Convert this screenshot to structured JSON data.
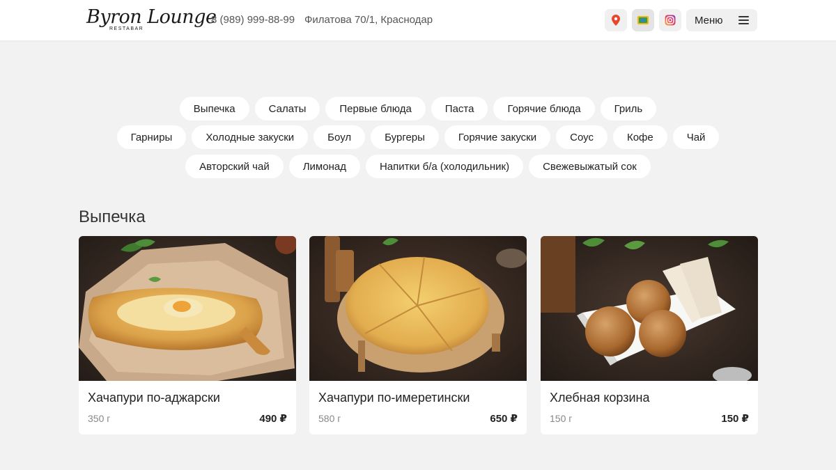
{
  "header": {
    "logo_script": "Byron Lounge",
    "logo_sub": "RESTABAR",
    "phone": "8 (989) 999-88-99",
    "address": "Филатова 70/1, Краснодар",
    "icons": [
      "map-pin-icon",
      "gallery-icon",
      "instagram-icon"
    ],
    "menu_label": "Меню"
  },
  "categories": {
    "row1": [
      "Выпечка",
      "Салаты",
      "Первые блюда",
      "Паста",
      "Горячие блюда",
      "Гриль"
    ],
    "row2": [
      "Гарниры",
      "Холодные закуски",
      "Боул",
      "Бургеры",
      "Горячие закуски",
      "Соус",
      "Кофе",
      "Чай"
    ],
    "row3": [
      "Авторский чай",
      "Лимонад",
      "Напитки б/а (холодильник)",
      "Свежевыжатый сок"
    ]
  },
  "section": {
    "title": "Выпечка",
    "items": [
      {
        "name": "Хачапури по-аджарски",
        "weight": "350 г",
        "price": "490 ₽"
      },
      {
        "name": "Хачапури по-имеретински",
        "weight": "580 г",
        "price": "650 ₽"
      },
      {
        "name": "Хлебная корзина",
        "weight": "150 г",
        "price": "150 ₽"
      }
    ]
  },
  "colors": {
    "background": "#f2f2f2",
    "card": "#ffffff",
    "map_pin": "#e8472e",
    "instagram": "#d6249f"
  }
}
